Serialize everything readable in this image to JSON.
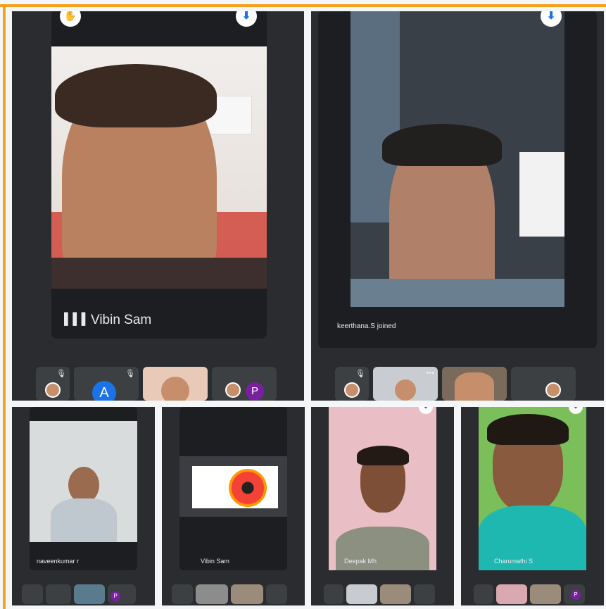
{
  "meeting": {
    "tiles": [
      {
        "id": "vibin",
        "name": "Vibin Sam"
      },
      {
        "id": "keerthana",
        "name": "keerthana.S joined"
      },
      {
        "id": "naveen",
        "name": "naveenkumar r"
      },
      {
        "id": "presentation",
        "name": "Vibin Sam"
      },
      {
        "id": "deepak",
        "name": "Deepak Mh"
      },
      {
        "id": "charumathi",
        "name": "Charumathi S"
      }
    ],
    "badges": {
      "a": "A",
      "p": "P"
    },
    "icons": {
      "pin": "pin-icon",
      "raise_hand": "hand-icon",
      "mic_off": "mic-off-icon",
      "audio_bars": "audio-level-icon",
      "more": "more-icon"
    }
  }
}
